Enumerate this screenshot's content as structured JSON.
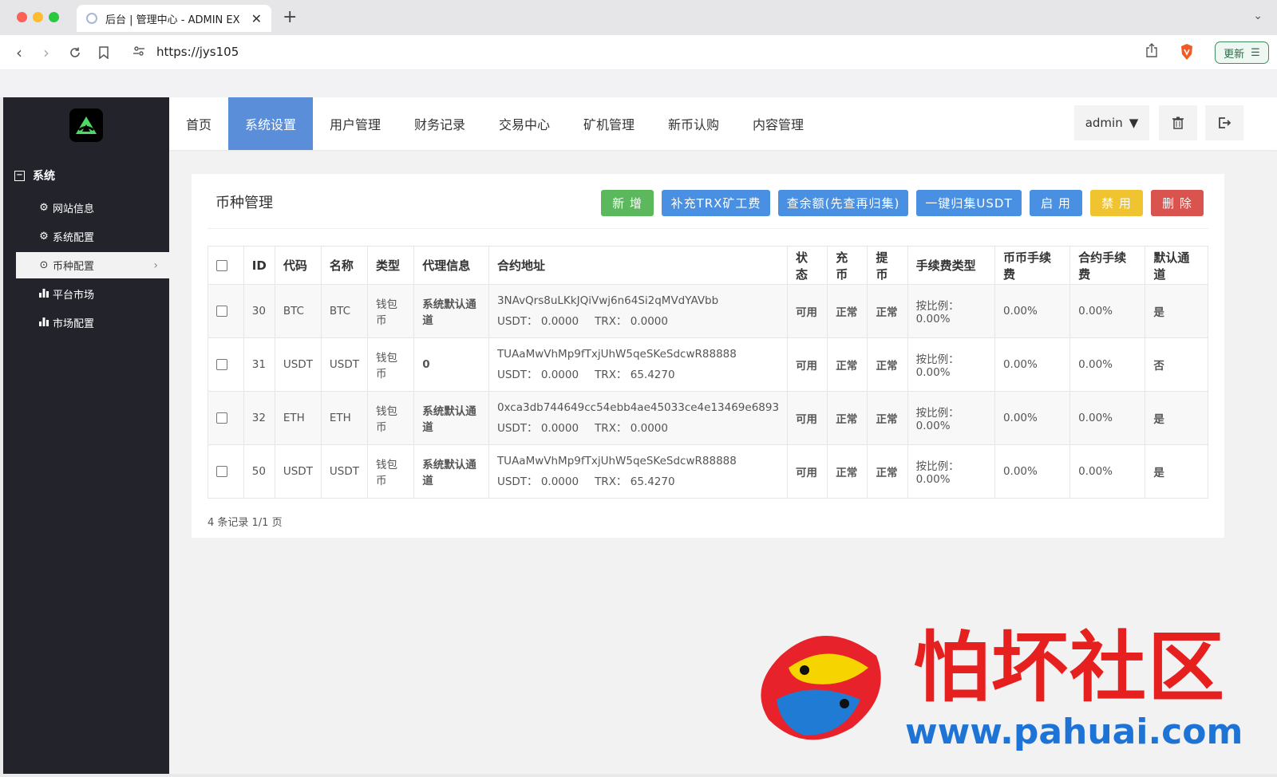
{
  "browser": {
    "tab_title": "后台 | 管理中心 - ADMIN EX",
    "url": "https://jys105",
    "update_label": "更新"
  },
  "sidebar": {
    "group_label": "系统",
    "items": [
      {
        "label": "网站信息",
        "icon": "gear-icon"
      },
      {
        "label": "系统配置",
        "icon": "gear-icon"
      },
      {
        "label": "币种配置",
        "icon": "circle-dot-icon"
      },
      {
        "label": "平台市场",
        "icon": "bar-chart-icon"
      },
      {
        "label": "市场配置",
        "icon": "bar-chart-icon"
      }
    ]
  },
  "topnav": {
    "items": [
      "首页",
      "系统设置",
      "用户管理",
      "财务记录",
      "交易中心",
      "矿机管理",
      "新币认购",
      "内容管理"
    ],
    "user": "admin"
  },
  "card": {
    "title": "币种管理",
    "buttons": [
      "新 增",
      "补充TRX矿工费",
      "查余额(先查再归集)",
      "一键归集USDT",
      "启 用",
      "禁 用",
      "删 除"
    ],
    "footer": "4 条记录 1/1 页"
  },
  "table": {
    "headers": [
      "ID",
      "代码",
      "名称",
      "类型",
      "代理信息",
      "合约地址",
      "状态",
      "充币",
      "提币",
      "手续费类型",
      "币币手续费",
      "合约手续费",
      "默认通道"
    ],
    "rows": [
      {
        "id": "30",
        "code": "BTC",
        "name": "BTC",
        "type": "钱包币",
        "agent": "系统默认通道",
        "address": "3NAvQrs8uLKkJQiVwj6n64Si2qMVdYAVbb",
        "usdt": "USDT： 0.0000",
        "trx": "TRX： 0.0000",
        "status": "可用",
        "deposit": "正常",
        "withdraw": "正常",
        "fee_type": "按比例：0.00%",
        "spot_fee": "0.00%",
        "contract_fee": "0.00%",
        "default": "是"
      },
      {
        "id": "31",
        "code": "USDT",
        "name": "USDT",
        "type": "钱包币",
        "agent": "0",
        "address": "TUAaMwVhMp9fTxjUhW5qeSKeSdcwR88888",
        "usdt": "USDT： 0.0000",
        "trx": "TRX： 65.4270",
        "status": "可用",
        "deposit": "正常",
        "withdraw": "正常",
        "fee_type": "按比例：0.00%",
        "spot_fee": "0.00%",
        "contract_fee": "0.00%",
        "default": "否"
      },
      {
        "id": "32",
        "code": "ETH",
        "name": "ETH",
        "type": "钱包币",
        "agent": "系统默认通道",
        "address": "0xca3db744649cc54ebb4ae45033ce4e13469e6893",
        "usdt": "USDT： 0.0000",
        "trx": "TRX： 0.0000",
        "status": "可用",
        "deposit": "正常",
        "withdraw": "正常",
        "fee_type": "按比例：0.00%",
        "spot_fee": "0.00%",
        "contract_fee": "0.00%",
        "default": "是"
      },
      {
        "id": "50",
        "code": "USDT",
        "name": "USDT",
        "type": "钱包币",
        "agent": "系统默认通道",
        "address": "TUAaMwVhMp9fTxjUhW5qeSKeSdcwR88888",
        "usdt": "USDT： 0.0000",
        "trx": "TRX： 65.4270",
        "status": "可用",
        "deposit": "正常",
        "withdraw": "正常",
        "fee_type": "按比例：0.00%",
        "spot_fee": "0.00%",
        "contract_fee": "0.00%",
        "default": "是"
      }
    ]
  },
  "watermark": {
    "title": "怕坏社区",
    "url": "www.pahuai.com"
  },
  "colors": {
    "sidebar_bg": "#23232c",
    "nav_active": "#5b8ed8",
    "btn_green": "#5cb85c",
    "btn_blue": "#4a90e2",
    "btn_yellow": "#f0c330",
    "btn_red": "#d9534f"
  }
}
